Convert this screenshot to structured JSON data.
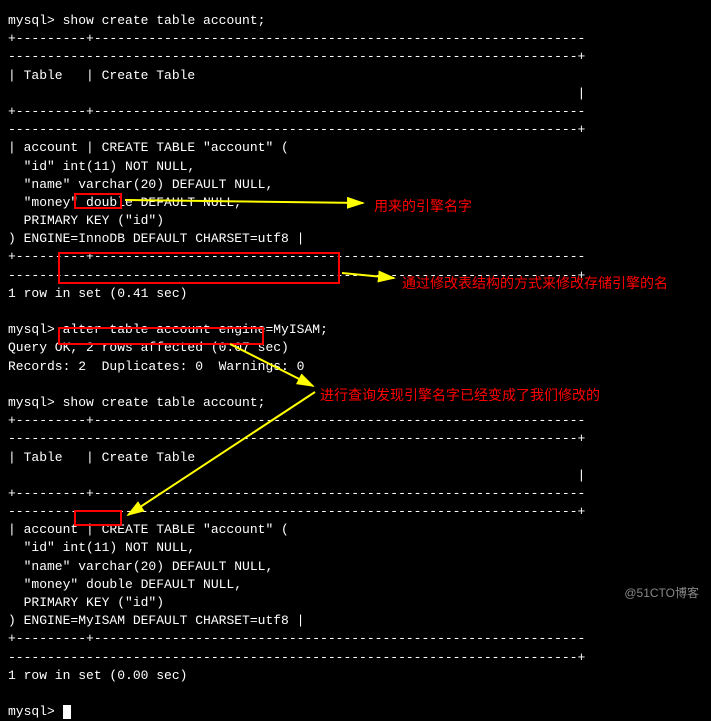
{
  "terminal": {
    "prompt": "mysql>",
    "cmd1": "show create table account;",
    "divider_top": "+---------+---------------------------------------------------------------",
    "dashes": "-------------------------------------------------------------------------+",
    "header_row": "| Table   | Create Table",
    "header_end": "                                                                         |",
    "divider_mid": "+---------+---------------------------------------------------------------",
    "create1_l1": "| account | CREATE TABLE \"account\" (",
    "create1_l2": "  \"id\" int(11) NOT NULL,",
    "create1_l3": "  \"name\" varchar(20) DEFAULT NULL,",
    "create1_l4": "  \"money\" double DEFAULT NULL,",
    "create1_l5": "  PRIMARY KEY (\"id\")",
    "create1_l6_pre": ") ENGINE=",
    "engine1": "InnoDB",
    "create1_l6_post": " DEFAULT CHARSET=utf8 |",
    "rows1": "1 row in set (0.41 sec)",
    "cmd2": "alter table account engine=MyISAM;",
    "query_ok": "Query OK, 2 rows affected (0.07 sec)",
    "records": "Records: 2  Duplicates: 0  Warnings: 0",
    "cmd3": "show create table account;",
    "create2_l1": "| account | CREATE TABLE \"account\" (",
    "create2_l2": "  \"id\" int(11) NOT NULL,",
    "create2_l3": "  \"name\" varchar(20) DEFAULT NULL,",
    "create2_l4": "  \"money\" double DEFAULT NULL,",
    "create2_l5": "  PRIMARY KEY (\"id\")",
    "create2_l6_pre": ") ENGINE=",
    "engine2": "MyISAM",
    "create2_l6_post": " DEFAULT CHARSET=utf8 |",
    "rows2": "1 row in set (0.00 sec)",
    "annotation1": "用来的引擎名字",
    "annotation2": "通过修改表结构的方式来修改存储引擎的名",
    "annotation3": "进行查询发现引擎名字已经变成了我们修改的",
    "watermark": "@51CTO博客"
  }
}
